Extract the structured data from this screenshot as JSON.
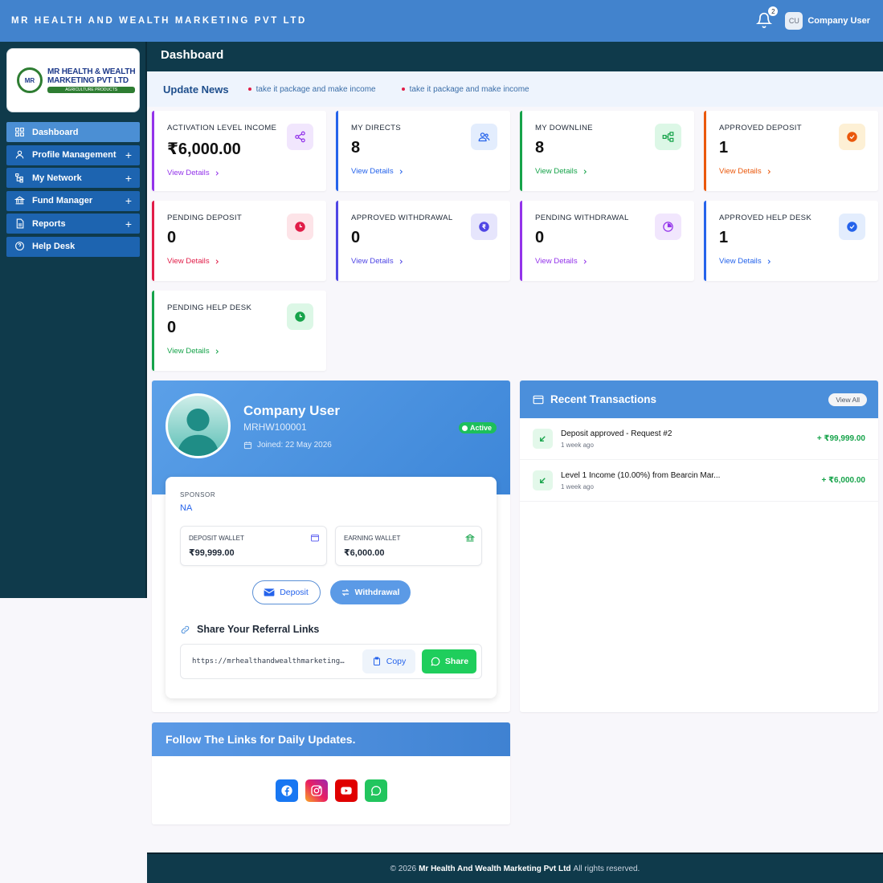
{
  "app": {
    "brand": "MR HEALTH AND WEALTH MARKETING PVT LTD"
  },
  "topbar": {
    "notification_count": "2",
    "user_initials": "CU",
    "user_name": "Company User"
  },
  "logo": {
    "line1": "MR HEALTH & WEALTH",
    "line2": "MARKETING PVT LTD",
    "tag": "AGRICULTURE PRODUCTS"
  },
  "sidebar": {
    "items": [
      {
        "label": "Dashboard",
        "icon": "grid-icon",
        "expandable": false
      },
      {
        "label": "Profile Management",
        "icon": "user-icon",
        "expandable": true
      },
      {
        "label": "My Network",
        "icon": "tree-icon",
        "expandable": true
      },
      {
        "label": "Fund Manager",
        "icon": "bank-icon",
        "expandable": true
      },
      {
        "label": "Reports",
        "icon": "file-icon",
        "expandable": true
      },
      {
        "label": "Help Desk",
        "icon": "help-icon",
        "expandable": false
      }
    ],
    "expand_symbol": "+"
  },
  "page": {
    "title": "Dashboard"
  },
  "news": {
    "title": "Update News",
    "items": [
      "take it package and make income",
      "take it package and make income"
    ]
  },
  "cards": [
    {
      "title": "ACTIVATION LEVEL INCOME",
      "value": "₹6,000.00",
      "link": "View Details",
      "accent": "#9333ea",
      "icon_bg": "#f1e6fd",
      "icon": "share-icon"
    },
    {
      "title": "MY DIRECTS",
      "value": "8",
      "link": "View Details",
      "accent": "#2563eb",
      "icon_bg": "#e3edfd",
      "icon": "users-icon"
    },
    {
      "title": "MY DOWNLINE",
      "value": "8",
      "link": "View Details",
      "accent": "#16a34a",
      "icon_bg": "#dcf7e6",
      "icon": "sitemap-icon"
    },
    {
      "title": "APPROVED DEPOSIT",
      "value": "1",
      "link": "View Details",
      "accent": "#ea580c",
      "icon_bg": "#fdf0d5",
      "icon": "check-circle-icon"
    },
    {
      "title": "PENDING DEPOSIT",
      "value": "0",
      "link": "View Details",
      "accent": "#e11d48",
      "icon_bg": "#fde4e8",
      "icon": "clock-icon"
    },
    {
      "title": "APPROVED WITHDRAWAL",
      "value": "0",
      "link": "View Details",
      "accent": "#4f46e5",
      "icon_bg": "#e6e5fc",
      "icon": "rupee-icon"
    },
    {
      "title": "PENDING WITHDRAWAL",
      "value": "0",
      "link": "View Details",
      "accent": "#9333ea",
      "icon_bg": "#f1e6fd",
      "icon": "pie-icon"
    },
    {
      "title": "APPROVED HELP DESK",
      "value": "1",
      "link": "View Details",
      "accent": "#2563eb",
      "icon_bg": "#e3edfd",
      "icon": "check-badge-icon"
    },
    {
      "title": "PENDING HELP DESK",
      "value": "0",
      "link": "View Details",
      "accent": "#16a34a",
      "icon_bg": "#dcf7e6",
      "icon": "clock-icon"
    }
  ],
  "profile": {
    "name": "Company User",
    "id": "MRHW100001",
    "joined": "Joined: 22 May 2026",
    "status": "Active",
    "sponsor_label": "SPONSOR",
    "sponsor_value": "NA",
    "deposit_wallet_label": "DEPOSIT WALLET",
    "deposit_wallet_value": "₹99,999.00",
    "earning_wallet_label": "EARNING WALLET",
    "earning_wallet_value": "₹6,000.00",
    "deposit_btn": "Deposit",
    "withdrawal_btn": "Withdrawal",
    "referral_title": "Share Your Referral Links",
    "referral_link": "https://mrhealthandwealthmarketing…",
    "copy_btn": "Copy",
    "share_btn": "Share"
  },
  "transactions": {
    "title": "Recent Transactions",
    "view_all": "View All",
    "rows": [
      {
        "title": "Deposit approved - Request #2",
        "time": "1 week ago",
        "amount": "+ ₹99,999.00"
      },
      {
        "title": "Level 1 Income (10.00%) from Bearcin Mar...",
        "time": "1 week ago",
        "amount": "+ ₹6,000.00"
      }
    ]
  },
  "follow": {
    "title": "Follow The Links for Daily Updates.",
    "socials": [
      "facebook-icon",
      "instagram-icon",
      "youtube-icon",
      "whatsapp-icon"
    ]
  },
  "footer": {
    "prefix": "© 2026",
    "company": "Mr Health And Wealth Marketing Pvt Ltd",
    "suffix": "All rights reserved."
  }
}
